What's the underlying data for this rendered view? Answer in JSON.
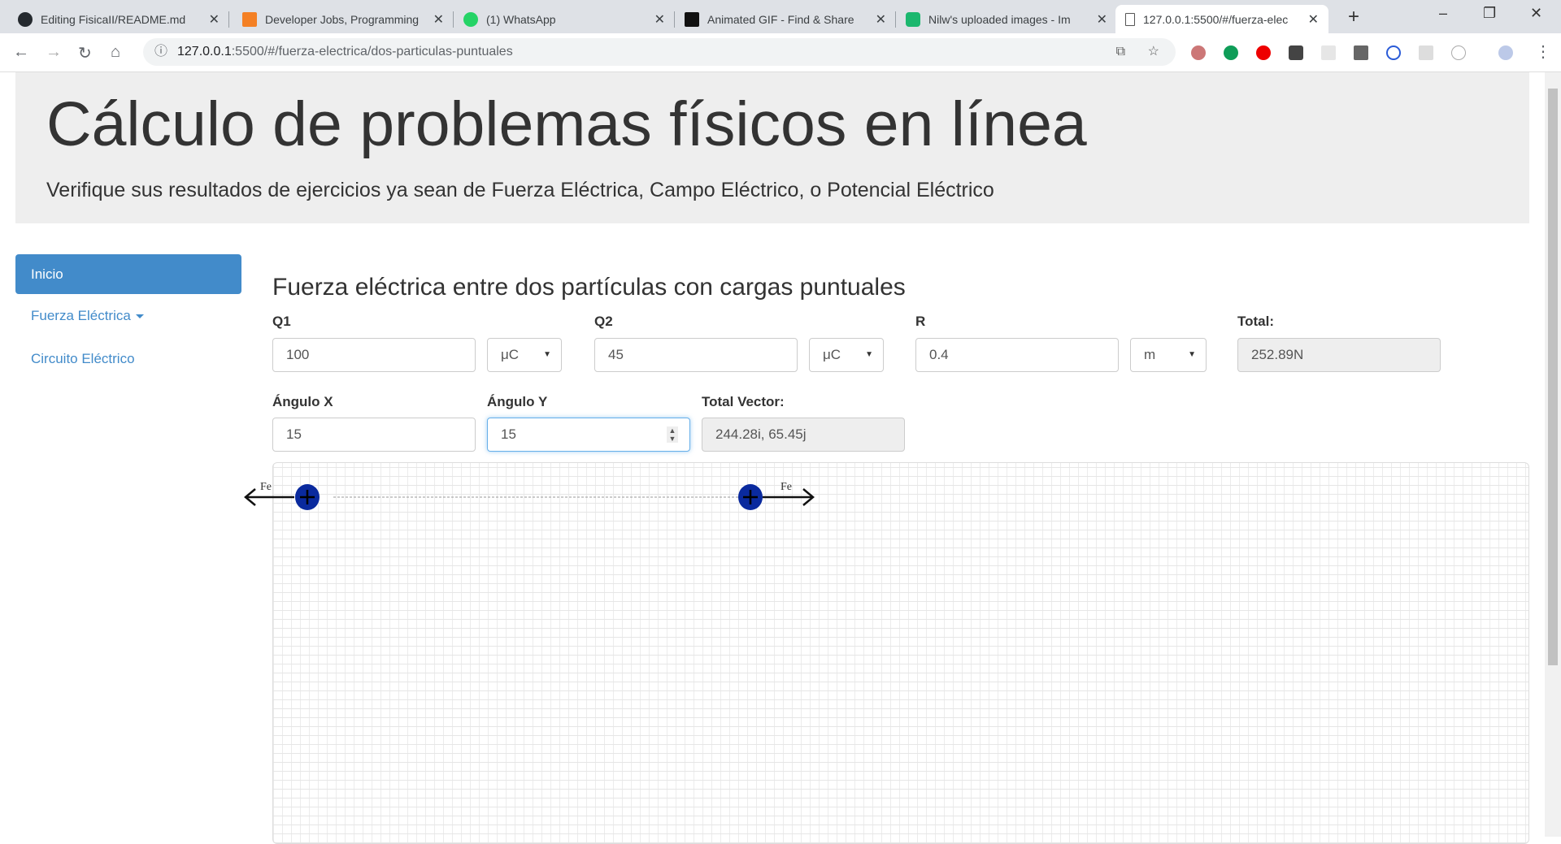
{
  "browser": {
    "tabs": [
      {
        "title": "Editing FisicaII/README.md",
        "icon": "github-icon",
        "color": "#24292e"
      },
      {
        "title": "Developer Jobs, Programming",
        "icon": "stackoverflow-icon",
        "color": "#f48024"
      },
      {
        "title": "(1) WhatsApp",
        "icon": "whatsapp-icon",
        "color": "#25d366"
      },
      {
        "title": "Animated GIF - Find & Share",
        "icon": "giphy-icon",
        "color": "#111111"
      },
      {
        "title": "Nilw's uploaded images - Im",
        "icon": "imgur-icon",
        "color": "#1bb76e"
      },
      {
        "title": "127.0.0.1:5500/#/fuerza-elec",
        "icon": "page-icon",
        "color": "#ffffff"
      }
    ],
    "url_host": "127.0.0.1",
    "url_rest": ":5500/#/fuerza-electrica/dos-particulas-puntuales"
  },
  "header": {
    "title": "Cálculo de problemas físicos en línea",
    "subtitle": "Verifique sus resultados de ejercicios ya sean de Fuerza Eléctrica, Campo Eléctrico, o Potencial Eléctrico"
  },
  "sidebar": {
    "items": [
      {
        "label": "Inicio"
      },
      {
        "label": "Fuerza Eléctrica"
      },
      {
        "label": "Circuito Eléctrico"
      }
    ]
  },
  "main": {
    "heading": "Fuerza eléctrica entre dos partículas con cargas puntuales",
    "q1": {
      "label": "Q1",
      "value": "100",
      "unit": "μC"
    },
    "q2": {
      "label": "Q2",
      "value": "45",
      "unit": "μC"
    },
    "r": {
      "label": "R",
      "value": "0.4",
      "unit": "m"
    },
    "total": {
      "label": "Total:",
      "value": "252.89N"
    },
    "angle_x": {
      "label": "Ángulo X",
      "value": "15"
    },
    "angle_y": {
      "label": "Ángulo Y",
      "value": "15"
    },
    "total_vector": {
      "label": "Total Vector:",
      "value": "244.28i, 65.45j"
    },
    "diagram": {
      "force_label": "Fe",
      "charge_color": "#0a2a9e"
    }
  }
}
